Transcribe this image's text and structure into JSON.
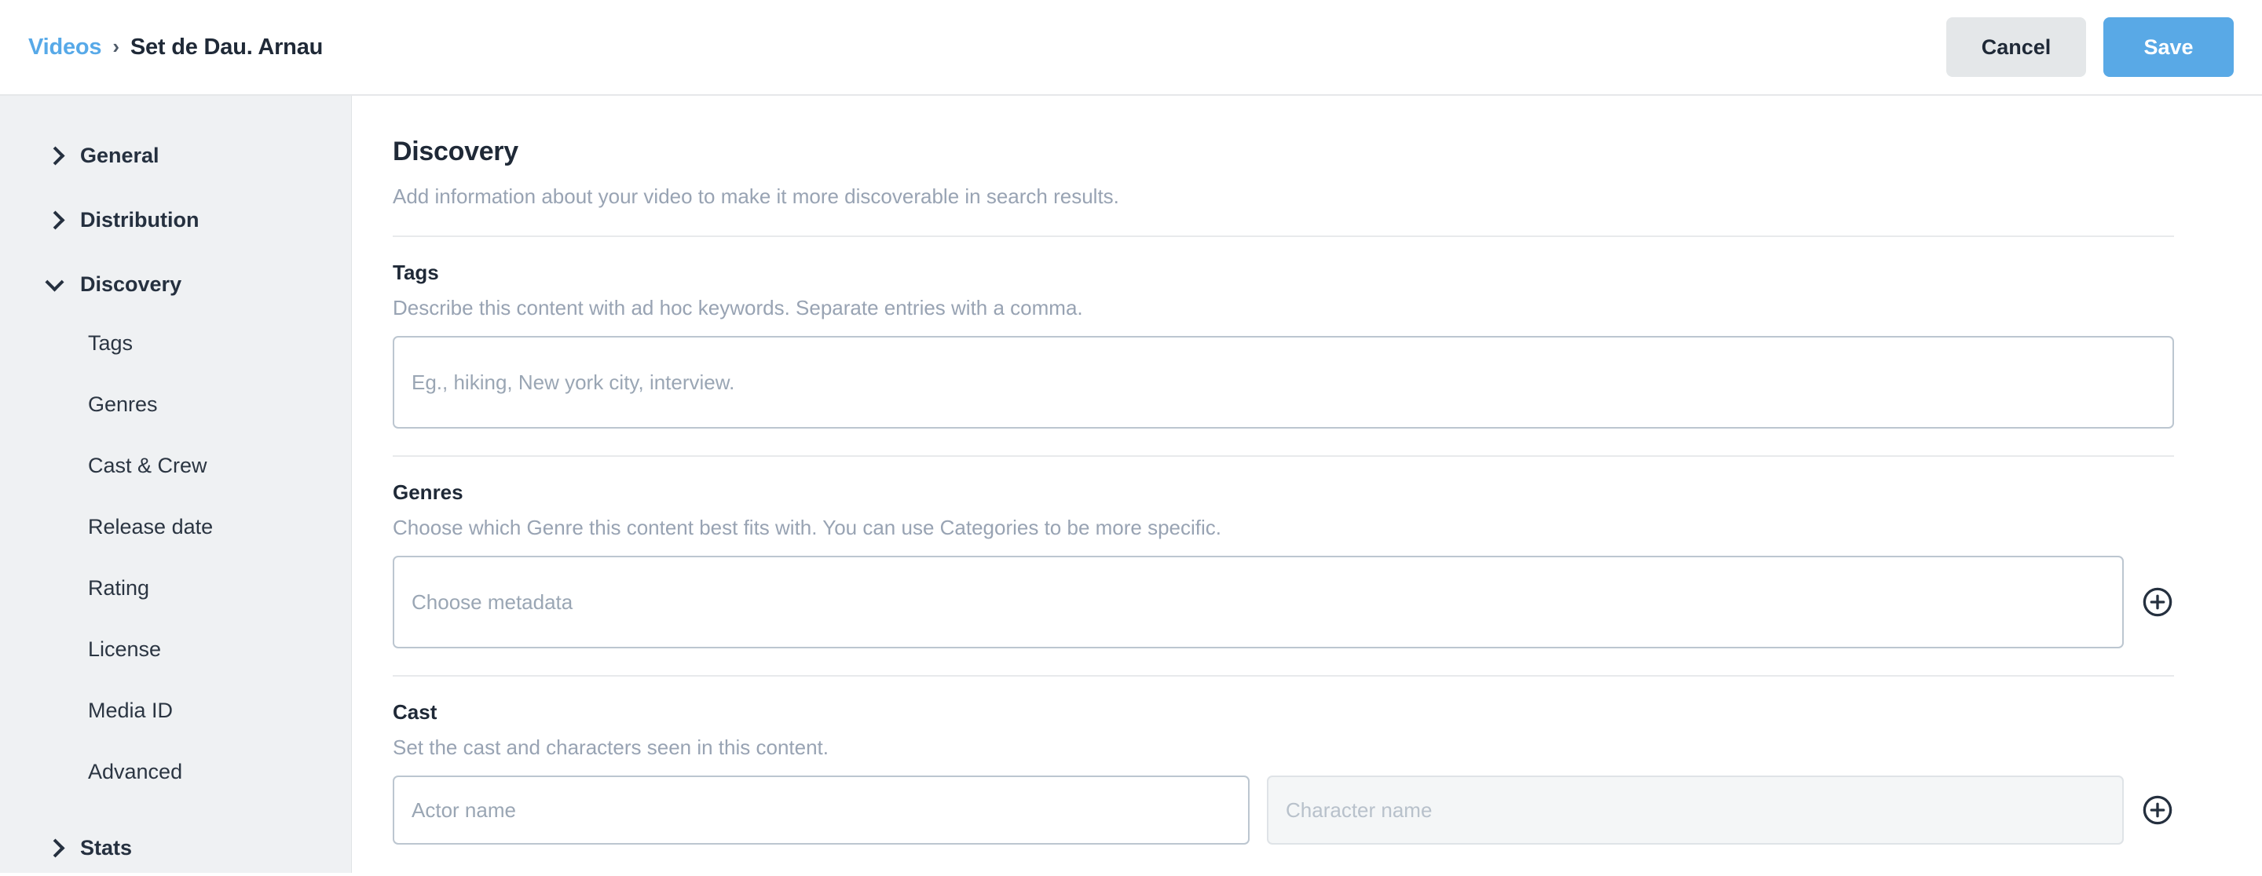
{
  "topbar": {
    "breadcrumb": {
      "root_label": "Videos",
      "separator": "›",
      "current_label": "Set de Dau. Arnau"
    },
    "cancel_label": "Cancel",
    "save_label": "Save",
    "accent_color": "#59a9e6",
    "link_color": "#57a9e8"
  },
  "sidebar": {
    "groups": [
      {
        "label": "General",
        "expanded": false,
        "icon": "chevron-right-icon"
      },
      {
        "label": "Distribution",
        "expanded": false,
        "icon": "chevron-right-icon"
      },
      {
        "label": "Discovery",
        "expanded": true,
        "icon": "chevron-down-icon"
      },
      {
        "label": "Stats",
        "expanded": false,
        "icon": "chevron-right-icon"
      }
    ],
    "discovery_items": [
      {
        "label": "Tags"
      },
      {
        "label": "Genres"
      },
      {
        "label": "Cast & Crew"
      },
      {
        "label": "Release date"
      },
      {
        "label": "Rating"
      },
      {
        "label": "License"
      },
      {
        "label": "Media ID"
      },
      {
        "label": "Advanced"
      }
    ]
  },
  "main": {
    "title": "Discovery",
    "subtitle": "Add information about your video to make it more discoverable in search results.",
    "sections": {
      "tags": {
        "label": "Tags",
        "help": "Describe this content with ad hoc keywords. Separate entries with a comma.",
        "input_value": "",
        "input_placeholder": "Eg., hiking, New york city, interview."
      },
      "genres": {
        "label": "Genres",
        "help": "Choose which Genre this content best fits with. You can use Categories to be more specific.",
        "input_value": "",
        "input_placeholder": "Choose metadata",
        "add_icon": "plus-circle-icon"
      },
      "cast": {
        "label": "Cast",
        "help": "Set the cast and characters seen in this content.",
        "actor_value": "",
        "actor_placeholder": "Actor name",
        "character_value": "",
        "character_placeholder": "Character name",
        "add_icon": "plus-circle-icon"
      }
    }
  }
}
